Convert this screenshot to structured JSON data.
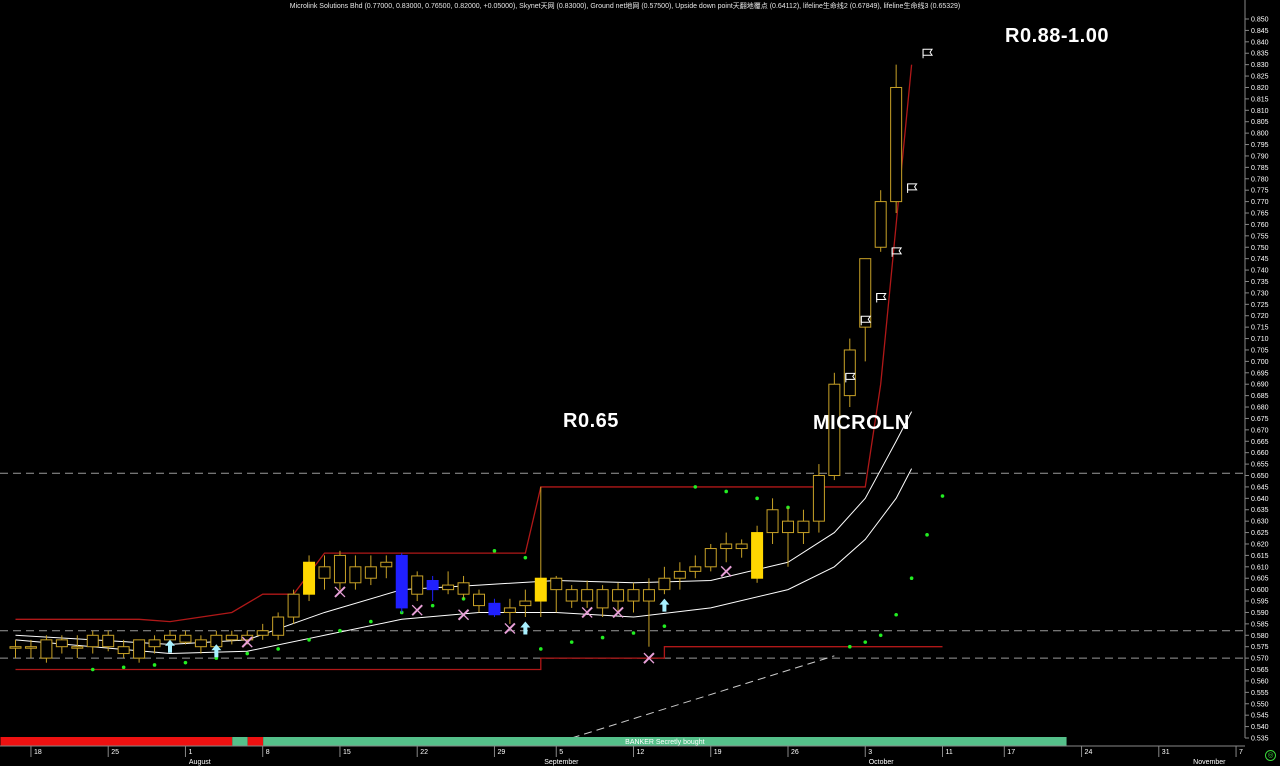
{
  "header": {
    "text": "Microlink Solutions Bhd (0.77000, 0.83000, 0.76500, 0.82000, +0.05000), Skynet天网 (0.83000), Ground net地网 (0.57500), Upside down point天翻地覆点 (0.64112), lifeline生命线2 (0.67849), lifeline生命线3 (0.65329)"
  },
  "annotations": {
    "top_target": "R0.88-1.00",
    "resistance": "R0.65",
    "ticker": "MICROLN"
  },
  "colors": {
    "background": "#000000",
    "up_candle": "#c9a227",
    "down_candle": "#2020ff",
    "doji_fill": "#ffd700",
    "skynet": "#b01818",
    "lifeline": "#ffffff",
    "sar_dots": "#22ee22",
    "dashed_lines": "#9a9a9a",
    "banker_red": "#ee1111",
    "banker_green": "#55c08a"
  },
  "icons": {
    "buy_arrow": "up-arrow-icon",
    "rocket": "rocket-icon",
    "flag": "flag-icon",
    "target_badge": "circle-icon"
  },
  "banker_bar": {
    "label": "BANKER Secretly bought"
  },
  "chart_data": {
    "type": "candlestick",
    "price_axis": {
      "min": 0.535,
      "max": 0.85,
      "step": 0.005,
      "labels": [
        "0.850",
        "0.845",
        "0.840",
        "0.835",
        "0.830",
        "0.825",
        "0.820",
        "0.815",
        "0.810",
        "0.805",
        "0.800",
        "0.795",
        "0.790",
        "0.785",
        "0.780",
        "0.775",
        "0.770",
        "0.765",
        "0.760",
        "0.755",
        "0.750",
        "0.745",
        "0.740",
        "0.735",
        "0.730",
        "0.725",
        "0.720",
        "0.715",
        "0.710",
        "0.705",
        "0.700",
        "0.695",
        "0.690",
        "0.685",
        "0.680",
        "0.675",
        "0.670",
        "0.665",
        "0.660",
        "0.655",
        "0.650",
        "0.645",
        "0.640",
        "0.635",
        "0.630",
        "0.625",
        "0.620",
        "0.615",
        "0.610",
        "0.605",
        "0.600",
        "0.595",
        "0.590",
        "0.585",
        "0.580",
        "0.575",
        "0.570",
        "0.565",
        "0.560",
        "0.555",
        "0.550",
        "0.545",
        "0.540",
        "0.535"
      ]
    },
    "date_axis": {
      "day_ticks": [
        {
          "label": "18",
          "bar": 1
        },
        {
          "label": "25",
          "bar": 6
        },
        {
          "label": "1",
          "bar": 11
        },
        {
          "label": "8",
          "bar": 16
        },
        {
          "label": "15",
          "bar": 21
        },
        {
          "label": "22",
          "bar": 26
        },
        {
          "label": "29",
          "bar": 31
        },
        {
          "label": "5",
          "bar": 35
        },
        {
          "label": "12",
          "bar": 40
        },
        {
          "label": "19",
          "bar": 45
        },
        {
          "label": "26",
          "bar": 50
        },
        {
          "label": "3",
          "bar": 55
        },
        {
          "label": "11",
          "bar": 60
        },
        {
          "label": "17",
          "bar": 64
        },
        {
          "label": "24",
          "bar": 69
        },
        {
          "label": "31",
          "bar": 74
        },
        {
          "label": "7",
          "bar": 79
        }
      ],
      "month_labels": [
        {
          "label": "August",
          "bar": 12
        },
        {
          "label": "September",
          "bar": 35
        },
        {
          "label": "October",
          "bar": 56
        },
        {
          "label": "November",
          "bar": 77
        }
      ]
    },
    "candles": [
      {
        "o": 0.575,
        "h": 0.578,
        "l": 0.57,
        "c": 0.575
      },
      {
        "o": 0.575,
        "h": 0.578,
        "l": 0.57,
        "c": 0.575
      },
      {
        "o": 0.57,
        "h": 0.58,
        "l": 0.568,
        "c": 0.578
      },
      {
        "o": 0.578,
        "h": 0.58,
        "l": 0.572,
        "c": 0.575
      },
      {
        "o": 0.575,
        "h": 0.58,
        "l": 0.57,
        "c": 0.575
      },
      {
        "o": 0.575,
        "h": 0.582,
        "l": 0.572,
        "c": 0.58
      },
      {
        "o": 0.58,
        "h": 0.582,
        "l": 0.573,
        "c": 0.575
      },
      {
        "o": 0.575,
        "h": 0.578,
        "l": 0.57,
        "c": 0.572
      },
      {
        "o": 0.57,
        "h": 0.578,
        "l": 0.568,
        "c": 0.578
      },
      {
        "o": 0.575,
        "h": 0.58,
        "l": 0.572,
        "c": 0.578
      },
      {
        "o": 0.578,
        "h": 0.582,
        "l": 0.575,
        "c": 0.58
      },
      {
        "o": 0.58,
        "h": 0.582,
        "l": 0.576,
        "c": 0.577
      },
      {
        "o": 0.575,
        "h": 0.58,
        "l": 0.572,
        "c": 0.578
      },
      {
        "o": 0.575,
        "h": 0.582,
        "l": 0.573,
        "c": 0.58
      },
      {
        "o": 0.58,
        "h": 0.582,
        "l": 0.576,
        "c": 0.578
      },
      {
        "o": 0.578,
        "h": 0.582,
        "l": 0.576,
        "c": 0.58
      },
      {
        "o": 0.58,
        "h": 0.585,
        "l": 0.578,
        "c": 0.582
      },
      {
        "o": 0.58,
        "h": 0.59,
        "l": 0.578,
        "c": 0.588
      },
      {
        "o": 0.588,
        "h": 0.6,
        "l": 0.585,
        "c": 0.598
      },
      {
        "o": 0.598,
        "h": 0.615,
        "l": 0.595,
        "c": 0.612
      },
      {
        "o": 0.605,
        "h": 0.615,
        "l": 0.6,
        "c": 0.61
      },
      {
        "o": 0.615,
        "h": 0.617,
        "l": 0.6,
        "c": 0.603
      },
      {
        "o": 0.603,
        "h": 0.615,
        "l": 0.6,
        "c": 0.61
      },
      {
        "o": 0.605,
        "h": 0.615,
        "l": 0.602,
        "c": 0.61
      },
      {
        "o": 0.61,
        "h": 0.615,
        "l": 0.605,
        "c": 0.612
      },
      {
        "o": 0.615,
        "h": 0.616,
        "l": 0.59,
        "c": 0.592
      },
      {
        "o": 0.598,
        "h": 0.608,
        "l": 0.595,
        "c": 0.606
      },
      {
        "o": 0.604,
        "h": 0.606,
        "l": 0.595,
        "c": 0.6
      },
      {
        "o": 0.6,
        "h": 0.608,
        "l": 0.598,
        "c": 0.602
      },
      {
        "o": 0.603,
        "h": 0.606,
        "l": 0.596,
        "c": 0.598
      },
      {
        "o": 0.598,
        "h": 0.6,
        "l": 0.59,
        "c": 0.593
      },
      {
        "o": 0.594,
        "h": 0.596,
        "l": 0.588,
        "c": 0.589
      },
      {
        "o": 0.59,
        "h": 0.596,
        "l": 0.585,
        "c": 0.592
      },
      {
        "o": 0.593,
        "h": 0.6,
        "l": 0.588,
        "c": 0.595
      },
      {
        "o": 0.595,
        "h": 0.645,
        "l": 0.588,
        "c": 0.605
      },
      {
        "o": 0.605,
        "h": 0.606,
        "l": 0.59,
        "c": 0.6
      },
      {
        "o": 0.6,
        "h": 0.602,
        "l": 0.592,
        "c": 0.595
      },
      {
        "o": 0.595,
        "h": 0.604,
        "l": 0.592,
        "c": 0.6
      },
      {
        "o": 0.592,
        "h": 0.602,
        "l": 0.588,
        "c": 0.6
      },
      {
        "o": 0.595,
        "h": 0.603,
        "l": 0.59,
        "c": 0.6
      },
      {
        "o": 0.595,
        "h": 0.603,
        "l": 0.59,
        "c": 0.6
      },
      {
        "o": 0.595,
        "h": 0.605,
        "l": 0.575,
        "c": 0.6
      },
      {
        "o": 0.6,
        "h": 0.61,
        "l": 0.598,
        "c": 0.605
      },
      {
        "o": 0.605,
        "h": 0.612,
        "l": 0.6,
        "c": 0.608
      },
      {
        "o": 0.608,
        "h": 0.615,
        "l": 0.605,
        "c": 0.61
      },
      {
        "o": 0.61,
        "h": 0.62,
        "l": 0.608,
        "c": 0.618
      },
      {
        "o": 0.618,
        "h": 0.625,
        "l": 0.612,
        "c": 0.62
      },
      {
        "o": 0.62,
        "h": 0.622,
        "l": 0.614,
        "c": 0.618
      },
      {
        "o": 0.605,
        "h": 0.628,
        "l": 0.603,
        "c": 0.625
      },
      {
        "o": 0.625,
        "h": 0.64,
        "l": 0.62,
        "c": 0.635
      },
      {
        "o": 0.63,
        "h": 0.636,
        "l": 0.61,
        "c": 0.625
      },
      {
        "o": 0.625,
        "h": 0.635,
        "l": 0.62,
        "c": 0.63
      },
      {
        "o": 0.63,
        "h": 0.655,
        "l": 0.625,
        "c": 0.65
      },
      {
        "o": 0.65,
        "h": 0.695,
        "l": 0.648,
        "c": 0.69
      },
      {
        "o": 0.685,
        "h": 0.71,
        "l": 0.68,
        "c": 0.705
      },
      {
        "o": 0.715,
        "h": 0.72,
        "l": 0.7,
        "c": 0.745
      },
      {
        "o": 0.75,
        "h": 0.775,
        "l": 0.748,
        "c": 0.77
      },
      {
        "o": 0.77,
        "h": 0.83,
        "l": 0.765,
        "c": 0.82
      }
    ],
    "candle_bars": [
      0,
      1,
      2,
      3,
      4,
      5,
      6,
      7,
      8,
      9,
      10,
      11,
      12,
      13,
      14,
      15,
      16,
      17,
      18,
      19,
      20,
      21,
      22,
      23,
      24,
      25,
      26,
      27,
      28,
      29,
      30,
      31,
      32,
      33,
      34,
      35,
      36,
      37,
      38,
      39,
      40,
      41,
      42,
      43,
      44,
      45,
      46,
      47,
      48,
      49,
      50,
      51,
      52,
      53,
      54,
      55,
      56,
      57
    ],
    "doji_bars": [
      19,
      34,
      48
    ],
    "down_bars": [
      25,
      27,
      31
    ],
    "skynet": [
      {
        "bar": 0,
        "v": 0.587
      },
      {
        "bar": 8,
        "v": 0.587
      },
      {
        "bar": 10,
        "v": 0.586
      },
      {
        "bar": 14,
        "v": 0.59
      },
      {
        "bar": 16,
        "v": 0.598
      },
      {
        "bar": 18,
        "v": 0.598
      },
      {
        "bar": 20,
        "v": 0.616
      },
      {
        "bar": 33,
        "v": 0.616
      },
      {
        "bar": 34,
        "v": 0.645
      },
      {
        "bar": 55,
        "v": 0.645
      },
      {
        "bar": 56,
        "v": 0.69
      },
      {
        "bar": 58,
        "v": 0.83
      }
    ],
    "groundnet": [
      {
        "bar": 0,
        "v": 0.565
      },
      {
        "bar": 33,
        "v": 0.565
      },
      {
        "bar": 34,
        "v": 0.57
      },
      {
        "bar": 41,
        "v": 0.57
      },
      {
        "bar": 42,
        "v": 0.575
      },
      {
        "bar": 60,
        "v": 0.575
      }
    ],
    "lifeline_upper": [
      {
        "bar": 0,
        "v": 0.58
      },
      {
        "bar": 10,
        "v": 0.576
      },
      {
        "bar": 15,
        "v": 0.578
      },
      {
        "bar": 20,
        "v": 0.59
      },
      {
        "bar": 25,
        "v": 0.6
      },
      {
        "bar": 30,
        "v": 0.602
      },
      {
        "bar": 35,
        "v": 0.604
      },
      {
        "bar": 40,
        "v": 0.603
      },
      {
        "bar": 45,
        "v": 0.604
      },
      {
        "bar": 50,
        "v": 0.612
      },
      {
        "bar": 53,
        "v": 0.625
      },
      {
        "bar": 55,
        "v": 0.64
      },
      {
        "bar": 57,
        "v": 0.665
      },
      {
        "bar": 58,
        "v": 0.678
      }
    ],
    "lifeline_lower": [
      {
        "bar": 0,
        "v": 0.578
      },
      {
        "bar": 10,
        "v": 0.572
      },
      {
        "bar": 15,
        "v": 0.573
      },
      {
        "bar": 20,
        "v": 0.58
      },
      {
        "bar": 25,
        "v": 0.587
      },
      {
        "bar": 30,
        "v": 0.59
      },
      {
        "bar": 35,
        "v": 0.59
      },
      {
        "bar": 40,
        "v": 0.588
      },
      {
        "bar": 45,
        "v": 0.592
      },
      {
        "bar": 50,
        "v": 0.6
      },
      {
        "bar": 53,
        "v": 0.61
      },
      {
        "bar": 55,
        "v": 0.622
      },
      {
        "bar": 57,
        "v": 0.64
      },
      {
        "bar": 58,
        "v": 0.653
      }
    ],
    "sar_dots": [
      {
        "bar": 5,
        "v": 0.565
      },
      {
        "bar": 7,
        "v": 0.566
      },
      {
        "bar": 9,
        "v": 0.567
      },
      {
        "bar": 11,
        "v": 0.568
      },
      {
        "bar": 13,
        "v": 0.57
      },
      {
        "bar": 15,
        "v": 0.572
      },
      {
        "bar": 17,
        "v": 0.574
      },
      {
        "bar": 19,
        "v": 0.578
      },
      {
        "bar": 21,
        "v": 0.582
      },
      {
        "bar": 23,
        "v": 0.586
      },
      {
        "bar": 25,
        "v": 0.59
      },
      {
        "bar": 27,
        "v": 0.593
      },
      {
        "bar": 29,
        "v": 0.596
      },
      {
        "bar": 31,
        "v": 0.617
      },
      {
        "bar": 33,
        "v": 0.614
      },
      {
        "bar": 34,
        "v": 0.574
      },
      {
        "bar": 36,
        "v": 0.577
      },
      {
        "bar": 38,
        "v": 0.579
      },
      {
        "bar": 40,
        "v": 0.581
      },
      {
        "bar": 42,
        "v": 0.584
      },
      {
        "bar": 44,
        "v": 0.645
      },
      {
        "bar": 46,
        "v": 0.643
      },
      {
        "bar": 48,
        "v": 0.64
      },
      {
        "bar": 50,
        "v": 0.636
      },
      {
        "bar": 52,
        "v": 0.632
      },
      {
        "bar": 54,
        "v": 0.575
      },
      {
        "bar": 55,
        "v": 0.577
      },
      {
        "bar": 56,
        "v": 0.58
      },
      {
        "bar": 57,
        "v": 0.589
      },
      {
        "bar": 58,
        "v": 0.605
      },
      {
        "bar": 59,
        "v": 0.624
      },
      {
        "bar": 60,
        "v": 0.641
      }
    ],
    "dashed_levels": [
      0.651,
      0.582,
      0.57
    ],
    "support_trend": [
      {
        "bar": 36,
        "v": 0.535
      },
      {
        "bar": 53,
        "v": 0.571
      }
    ],
    "up_arrows": [
      {
        "bar": 10,
        "v": 0.575
      },
      {
        "bar": 13,
        "v": 0.573
      },
      {
        "bar": 33,
        "v": 0.583
      },
      {
        "bar": 42,
        "v": 0.593
      }
    ],
    "rockets": [
      {
        "bar": 15,
        "v": 0.577
      },
      {
        "bar": 21,
        "v": 0.599
      },
      {
        "bar": 26,
        "v": 0.591
      },
      {
        "bar": 29,
        "v": 0.589
      },
      {
        "bar": 32,
        "v": 0.583
      },
      {
        "bar": 37,
        "v": 0.59
      },
      {
        "bar": 39,
        "v": 0.59
      },
      {
        "bar": 41,
        "v": 0.57
      },
      {
        "bar": 46,
        "v": 0.608
      }
    ],
    "flags": [
      {
        "bar": 54,
        "v": 0.693
      },
      {
        "bar": 55,
        "v": 0.718
      },
      {
        "bar": 56,
        "v": 0.728
      },
      {
        "bar": 57,
        "v": 0.748
      },
      {
        "bar": 58,
        "v": 0.776
      },
      {
        "bar": 59,
        "v": 0.835
      }
    ],
    "banker_segments": [
      {
        "from": 0,
        "to": 15,
        "color": "red"
      },
      {
        "from": 15,
        "to": 16,
        "color": "green"
      },
      {
        "from": 16,
        "to": 17,
        "color": "red"
      },
      {
        "from": 17,
        "to": 69,
        "color": "green"
      }
    ]
  }
}
